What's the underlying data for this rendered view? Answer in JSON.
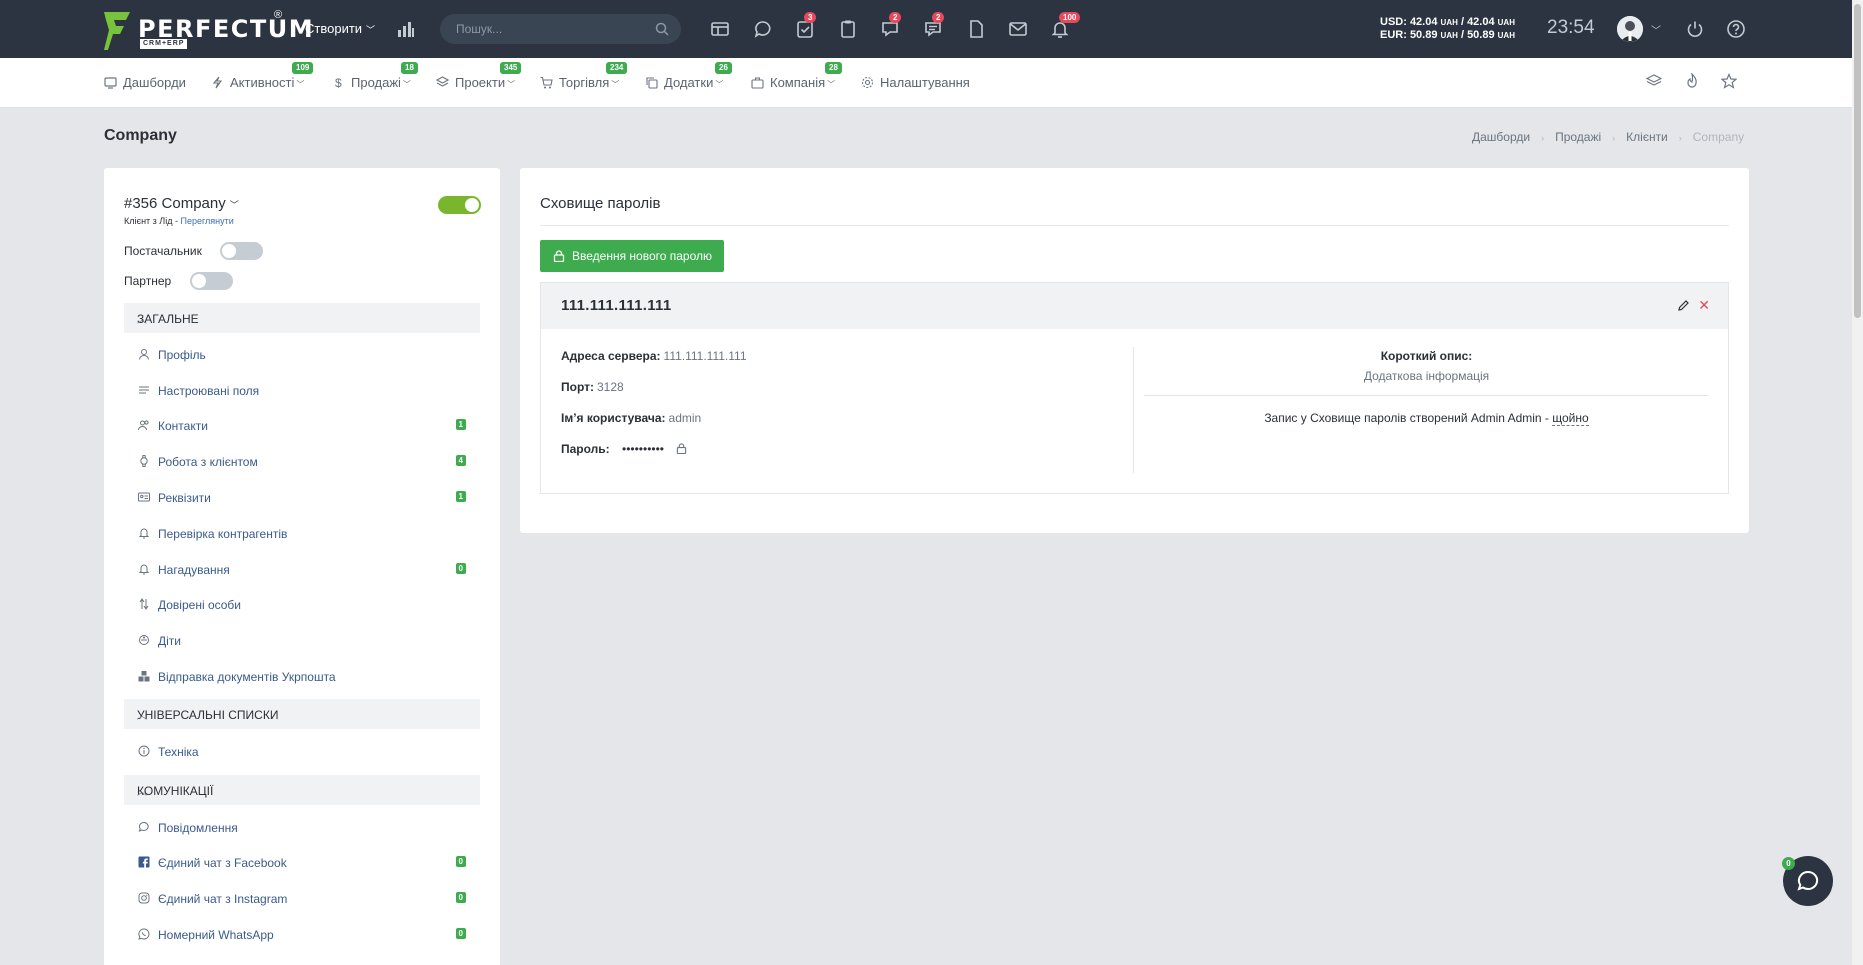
{
  "topbar": {
    "logo_text": "PERFECTUM",
    "logo_sub": "CRM+ERP",
    "logo_reg": "®",
    "create_label": "Створити",
    "search_placeholder": "Пошук...",
    "badges": {
      "tasks": "3",
      "chat": "2",
      "messages": "2",
      "notifications": "100"
    },
    "rate_usd": "USD: 42.04",
    "rate_usd_unit": "UAH",
    "rate_usd2": "/ 42.04",
    "rate_eur": "EUR: 50.89",
    "rate_eur_unit": "UAH",
    "rate_eur2": "/ 50.89",
    "time": "23:54"
  },
  "nav": {
    "items": [
      {
        "label": "Дашборди",
        "icon": "dashboard-icon",
        "badge": ""
      },
      {
        "label": "Активності",
        "icon": "bolt-icon",
        "badge": "109"
      },
      {
        "label": "Продажі",
        "icon": "dollar-icon",
        "badge": "18"
      },
      {
        "label": "Проекти",
        "icon": "layers-icon",
        "badge": "345"
      },
      {
        "label": "Торгівля",
        "icon": "cart-icon",
        "badge": "234"
      },
      {
        "label": "Додатки",
        "icon": "copy-icon",
        "badge": "26"
      },
      {
        "label": "Компанія",
        "icon": "briefcase-icon",
        "badge": "28"
      },
      {
        "label": "Налаштування",
        "icon": "gear-icon",
        "badge": ""
      }
    ]
  },
  "page": {
    "title": "Company",
    "breadcrumb": [
      "Дашборди",
      "Продажі",
      "Клієнти",
      "Company"
    ]
  },
  "client": {
    "name": "#356 Company",
    "sub_prefix": "Клієнт з Лід",
    "sub_link": "Переглянути",
    "supplier_label": "Постачальник",
    "partner_label": "Партнер",
    "sections": [
      {
        "title": "ЗАГАЛЬНЕ",
        "items": [
          {
            "label": "Профіль",
            "icon": "user-icon",
            "count": ""
          },
          {
            "label": "Настроювані поля",
            "icon": "lines-icon",
            "count": ""
          },
          {
            "label": "Контакти",
            "icon": "users-icon",
            "count": "1"
          },
          {
            "label": "Робота з клієнтом",
            "icon": "watch-icon",
            "count": "4"
          },
          {
            "label": "Реквізити",
            "icon": "id-card-icon",
            "count": "1"
          },
          {
            "label": "Перевірка контрагентів",
            "icon": "bell-icon",
            "count": ""
          },
          {
            "label": "Нагадування",
            "icon": "bell-icon",
            "count": "0"
          },
          {
            "label": "Довірені особи",
            "icon": "sort-icon",
            "count": ""
          },
          {
            "label": "Діти",
            "icon": "baby-icon",
            "count": ""
          },
          {
            "label": "Відправка документів Укрпошта",
            "icon": "boxes-icon",
            "count": ""
          }
        ]
      },
      {
        "title": "УНІВЕРСАЛЬНІ СПИСКИ",
        "items": [
          {
            "label": "Техніка",
            "icon": "info-icon",
            "count": ""
          }
        ]
      },
      {
        "title": "КОМУНІКАЦІЇ",
        "items": [
          {
            "label": "Повідомлення",
            "icon": "chat-icon",
            "count": ""
          },
          {
            "label": "Єдиний чат з Facebook",
            "icon": "facebook-icon",
            "count": "0"
          },
          {
            "label": "Єдиний чат з Instagram",
            "icon": "instagram-icon",
            "count": "0"
          },
          {
            "label": "Номерний WhatsApp",
            "icon": "whatsapp-icon",
            "count": "0"
          }
        ]
      }
    ]
  },
  "vault": {
    "title": "Сховище паролів",
    "new_button": "Введення нового паролю",
    "entry": {
      "host": "111.111.111.111",
      "server_label": "Адреса сервера:",
      "server_value": "111.111.111.111",
      "port_label": "Порт:",
      "port_value": "3128",
      "user_label": "Ім’я користувача:",
      "user_value": "admin",
      "password_label": "Пароль:",
      "password_value": "••••••••••",
      "short_desc_label": "Короткий опис:",
      "short_desc_value": "Додаткова інформація",
      "log_text": "Запис у Сховище паролів створений Admin Admin -",
      "log_time": "щойно"
    }
  },
  "chat_widget": {
    "badge": "0"
  },
  "colors": {
    "topbar": "#2b3440",
    "accent_green": "#3dab4e",
    "badge_red": "#e8485b",
    "link": "#3a5a8c"
  }
}
